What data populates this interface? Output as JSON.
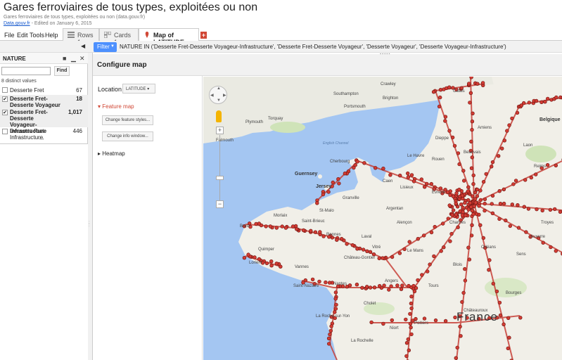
{
  "header": {
    "title": "Gares ferroviaires de tous types, exploitées ou non",
    "subtitle": "Gares ferroviaires de tous types, exploitées ou non (data.gouv.fr)",
    "source_link": "Data.gouv.fr",
    "edited": " - Edited on January 6, 2015"
  },
  "menu": [
    "File",
    "Edit",
    "Tools",
    "Help"
  ],
  "tabs": [
    {
      "label": "Rows 1",
      "icon": "rows-icon"
    },
    {
      "label": "Cards 1",
      "icon": "cards-icon"
    },
    {
      "label": "Map of LATITUDE",
      "icon": "map-pin-icon"
    }
  ],
  "toolbar": {
    "filter_label": "Filter",
    "filter_text": "NATURE IN ('Desserte Fret-Desserte Voyageur-Infrastructure', 'Desserte Fret-Desserte Voyageur', 'Desserte Voyageur', 'Desserte Voyageur-Infrastructure')"
  },
  "filter_panel": {
    "title": "NATURE",
    "find_label": "Find",
    "distinct_values": "8 distinct values",
    "items": [
      {
        "label": "Desserte Fret",
        "count": "67",
        "checked": false
      },
      {
        "label": "Desserte Fret-Desserte Voyageur",
        "count": "18",
        "checked": true
      },
      {
        "label": "Desserte Fret-Desserte Voyageur-Infrastructure",
        "count": "1,017",
        "checked": true
      },
      {
        "label": "Desserte Fret-Infrastructure",
        "count": "446",
        "checked": false
      }
    ]
  },
  "config": {
    "title": "Configure map",
    "location_label": "Location",
    "location_value": "LATITUDE",
    "feature_map": "Feature map",
    "change_styles": "Change feature styles...",
    "change_info": "Change info window...",
    "heatmap": "Heatmap"
  },
  "map_labels": {
    "france": "France",
    "belgique": "Belgique",
    "guernsey": "Guernsey",
    "jersey": "Jersey",
    "english_channel": "English Channel",
    "southampton": "Southampton",
    "portsmouth": "Portsmouth",
    "brighton": "Brighton",
    "plymouth": "Plymouth",
    "torquay": "Torquay",
    "falmouth": "Falmouth",
    "crawley": "Crawley",
    "cherbourg": "Cherbourg",
    "st_malo": "St-Malo",
    "brest": "Brest",
    "quimper": "Quimper",
    "rennes": "Rennes",
    "nantes": "Nantes",
    "saint_nazaire": "Saint-Nazaire",
    "la_rochelle": "La Rochelle",
    "niort": "Niort",
    "tours": "Tours",
    "le_mans": "Le Mans",
    "angers": "Angers",
    "caen": "Caen",
    "rouen": "Rouen",
    "lisieux": "Lisieux",
    "alencon": "Alençon",
    "argentan": "Argentan",
    "chartres": "Chartres",
    "orleans": "Orléans",
    "blois": "Blois",
    "poitiers": "Poitiers",
    "chateauroux": "Châteauroux",
    "bourges": "Bourges",
    "auxerre": "Auxerre",
    "troyes": "Troyes",
    "reims": "Reims",
    "amiens": "Amiens",
    "calais": "Calais",
    "lorient": "Lorient",
    "vannes": "Vannes",
    "laval": "Laval",
    "cholet": "Cholet",
    "evreux": "Évreux",
    "beauvais": "Beauvais",
    "laon": "Laon",
    "sens": "Sens",
    "chateau_gontier": "Château-Gontier",
    "morlaix": "Morlaix",
    "le_havre": "Le Havre",
    "dieppe": "Dieppe",
    "granville": "Granville",
    "saint_brieuc": "Saint-Brieuc",
    "vitre": "Vitré",
    "la_roche": "La Roche-sur-Yon"
  }
}
